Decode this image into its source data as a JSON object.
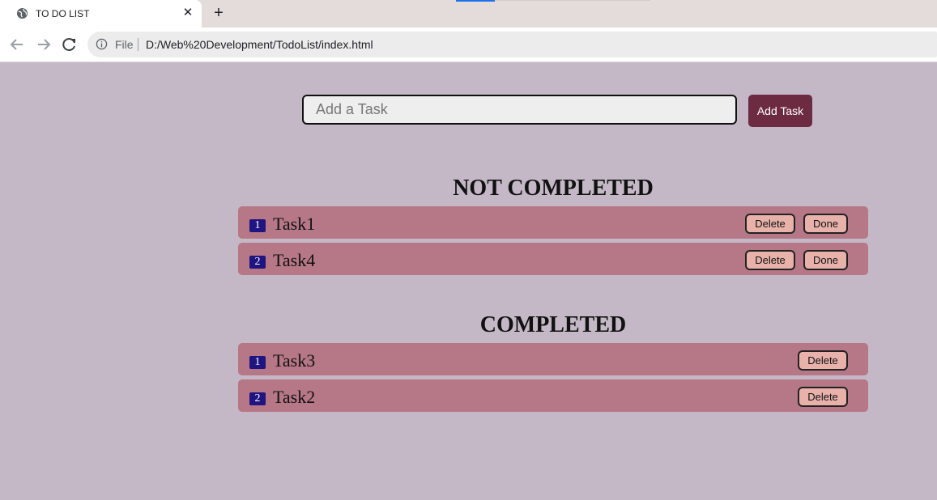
{
  "browser": {
    "tab_title": "TO DO LIST",
    "close_glyph": "✕",
    "new_tab_glyph": "+",
    "file_label": "File",
    "url": "D:/Web%20Development/TodoList/index.html"
  },
  "form": {
    "placeholder": "Add a Task",
    "value": "",
    "add_button": "Add Task"
  },
  "sections": {
    "not_completed": {
      "title": "NOT COMPLETED",
      "tasks": [
        {
          "num": "1",
          "name": "Task1",
          "delete": "Delete",
          "done": "Done"
        },
        {
          "num": "2",
          "name": "Task4",
          "delete": "Delete",
          "done": "Done"
        }
      ]
    },
    "completed": {
      "title": "COMPLETED",
      "tasks": [
        {
          "num": "1",
          "name": "Task3",
          "delete": "Delete"
        },
        {
          "num": "2",
          "name": "Task2",
          "delete": "Delete"
        }
      ]
    }
  },
  "colors": {
    "page_bg": "#c4b8c6",
    "row_bg": "#b67786",
    "button_bg": "#e8b2ab",
    "add_button_bg": "#6d2b41",
    "badge_bg": "#1f1480"
  },
  "icons": [
    "globe-icon",
    "close-icon",
    "plus-icon",
    "back-arrow-icon",
    "forward-arrow-icon",
    "reload-icon",
    "info-icon"
  ]
}
